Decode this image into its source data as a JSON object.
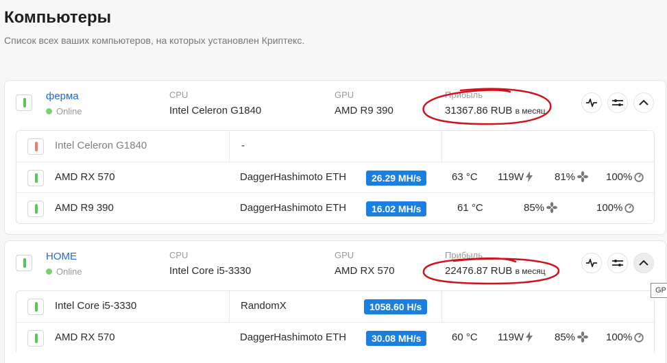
{
  "page": {
    "title": "Компьютеры",
    "subtitle": "Список всех ваших компьютеров, на которых установлен Криптекс."
  },
  "labels": {
    "cpu": "CPU",
    "gpu": "GPU",
    "profit": "Прибыль"
  },
  "computers": [
    {
      "name": "ферма",
      "status": "Online",
      "cpu": "Intel Celeron G1840",
      "gpu": "AMD R9 390",
      "profit_value": "31367.86 RUB",
      "profit_unit": "в месяц",
      "rows": [
        {
          "device": "Intel Celeron G1840",
          "algo": "-",
          "hashrate": "",
          "temp": "",
          "power": "",
          "fan": "",
          "load": "",
          "status_color": "red"
        },
        {
          "device": "AMD RX 570",
          "algo": "DaggerHashimoto ETH",
          "hashrate": "26.29 MH/s",
          "temp": "63 °C",
          "power": "119W",
          "fan": "81%",
          "load": "100%",
          "status_color": "green"
        },
        {
          "device": "AMD R9 390",
          "algo": "DaggerHashimoto ETH",
          "hashrate": "16.02 MH/s",
          "temp": "61 °C",
          "power": "",
          "fan": "85%",
          "load": "100%",
          "status_color": "green"
        }
      ]
    },
    {
      "name": "HOME",
      "status": "Online",
      "cpu": "Intel Core i5-3330",
      "gpu": "AMD RX 570",
      "profit_value": "22476.87 RUB",
      "profit_unit": "в месяц",
      "rows": [
        {
          "device": "Intel Core i5-3330",
          "algo": "RandomX",
          "hashrate": "1058.60 H/s",
          "temp": "",
          "power": "",
          "fan": "",
          "load": "",
          "status_color": "green"
        },
        {
          "device": "AMD RX 570",
          "algo": "DaggerHashimoto ETH",
          "hashrate": "30.08 MH/s",
          "temp": "60 °C",
          "power": "119W",
          "fan": "85%",
          "load": "100%",
          "status_color": "green"
        }
      ]
    }
  ],
  "tooltip": {
    "text": "GP"
  },
  "colors": {
    "accent": "#1a7fe0",
    "online": "#7bcf6c",
    "error": "#f07b6c",
    "annotation": "#d0121b"
  },
  "icons": [
    "activity-icon",
    "sliders-icon",
    "chevron-up-icon",
    "bolt-icon",
    "fan-icon",
    "gauge-icon"
  ]
}
